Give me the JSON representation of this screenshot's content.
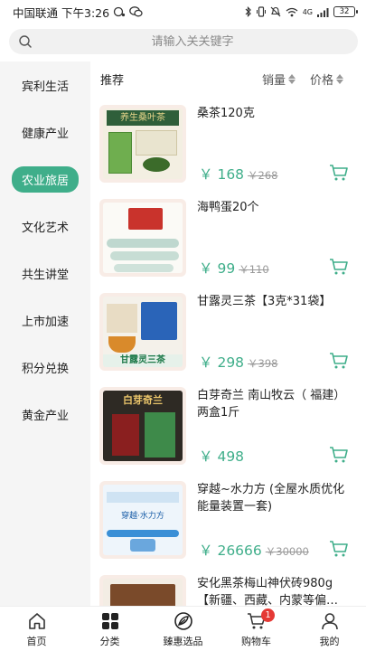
{
  "status_bar": {
    "carrier": "中国联通",
    "time": "下午3:26",
    "network": "4G",
    "battery": "32"
  },
  "search": {
    "placeholder": "请输入关关键字"
  },
  "sidebar": {
    "items": [
      {
        "label": "宾利生活"
      },
      {
        "label": "健康产业"
      },
      {
        "label": "农业旅居"
      },
      {
        "label": "文化艺术"
      },
      {
        "label": "共生讲堂"
      },
      {
        "label": "上市加速"
      },
      {
        "label": "积分兑换"
      },
      {
        "label": "黄金产业"
      }
    ],
    "active_index": 2
  },
  "sort": {
    "recommend": "推荐",
    "sales": "销量",
    "price": "价格"
  },
  "products": [
    {
      "title": "桑茶120克",
      "currency": "￥",
      "price": "168",
      "original_price": "268",
      "image_text": "养生桑叶茶"
    },
    {
      "title": "海鸭蛋20个",
      "currency": "￥",
      "price": "99",
      "original_price": "110",
      "image_text": ""
    },
    {
      "title": "甘露灵三茶【3克*31袋】",
      "currency": "￥",
      "price": "298",
      "original_price": "398",
      "image_text": "甘露灵三茶"
    },
    {
      "title": "白芽奇兰 南山牧云（ 福建）两盒1斤",
      "currency": "￥",
      "price": "498",
      "original_price": "",
      "image_text": "白芽奇兰"
    },
    {
      "title": "穿越~水力方 (全屋水质优化能量装置一套)",
      "currency": "￥",
      "price": "26666",
      "original_price": "30000",
      "image_text": "穿越·水力方"
    },
    {
      "title": "安化黑茶梅山神伏砖980g【新疆、西藏、内蒙等偏…",
      "currency": "",
      "price": "",
      "original_price": "",
      "image_text": ""
    }
  ],
  "tabbar": {
    "items": [
      {
        "label": "首页",
        "icon": "home-icon"
      },
      {
        "label": "分类",
        "icon": "category-icon"
      },
      {
        "label": "臻惠选品",
        "icon": "selection-icon"
      },
      {
        "label": "购物车",
        "icon": "cart-icon",
        "badge": "1"
      },
      {
        "label": "我的",
        "icon": "user-icon"
      }
    ]
  },
  "colors": {
    "accent": "#3fae8a",
    "badge": "#e53935",
    "sidebar_bg": "#f5f5f5"
  }
}
